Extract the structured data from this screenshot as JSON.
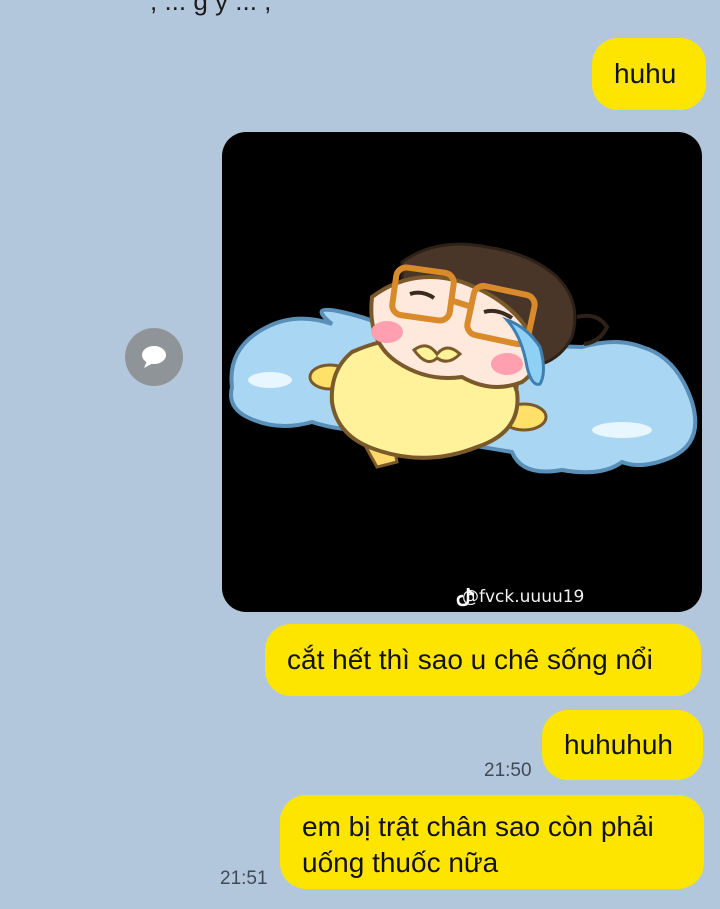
{
  "messages": {
    "top_partial": ", ... g y ... ,",
    "m1": "huhu",
    "media": {
      "watermark": "@fvck.uuuu19",
      "tiktok_icon": "tiktok-logo"
    },
    "m2": "cắt hết thì sao u chê sống nổi",
    "m3": "huhuhuh",
    "m3_time": "21:50",
    "m4_line1": "em bị trật chân sao còn phải",
    "m4_line2": "uống thuốc nữa",
    "m4_time": "21:51"
  },
  "colors": {
    "background": "#b3c7dc",
    "bubble": "#fee500",
    "share_button": "#8f9498"
  }
}
